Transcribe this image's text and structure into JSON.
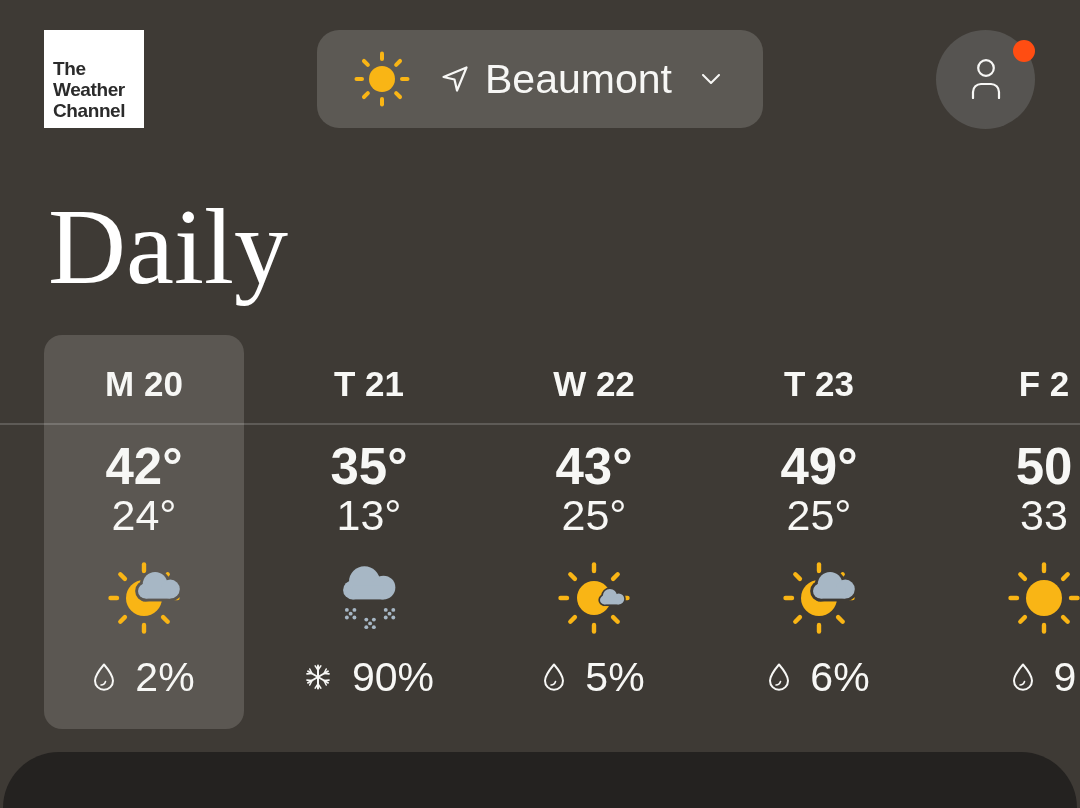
{
  "logo": {
    "text": "The Weather Channel"
  },
  "location": {
    "name": "Beaumont"
  },
  "account": {
    "notification": true
  },
  "title": "Daily",
  "days": [
    {
      "date": "M 20",
      "high": "42°",
      "low": "24°",
      "kind": "partlycloudy",
      "precip": {
        "kind": "rain",
        "chance": "2%"
      },
      "selected": true
    },
    {
      "date": "T 21",
      "high": "35°",
      "low": "13°",
      "kind": "snow",
      "precip": {
        "kind": "snow",
        "chance": "90%"
      },
      "selected": false
    },
    {
      "date": "W 22",
      "high": "43°",
      "low": "25°",
      "kind": "mostlysunny",
      "precip": {
        "kind": "rain",
        "chance": "5%"
      },
      "selected": false
    },
    {
      "date": "T 23",
      "high": "49°",
      "low": "25°",
      "kind": "partlycloudy",
      "precip": {
        "kind": "rain",
        "chance": "6%"
      },
      "selected": false
    },
    {
      "date": "F 2",
      "high": "50",
      "low": "33",
      "kind": "sunny",
      "precip": {
        "kind": "rain",
        "chance": "9"
      },
      "selected": false
    }
  ]
}
